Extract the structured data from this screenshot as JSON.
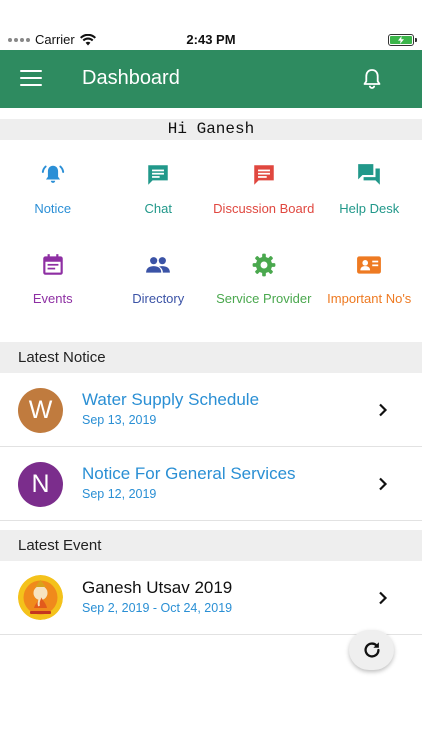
{
  "status_bar": {
    "carrier": "Carrier",
    "time": "2:43 PM",
    "battery_color": "#3bb54a"
  },
  "app_bar": {
    "title": "Dashboard",
    "menu_icon": "menu-icon",
    "notification_icon": "bell-icon",
    "background_color": "#2e8b60"
  },
  "greeting": "Hi Ganesh",
  "grid": {
    "items": [
      {
        "label": "Notice",
        "icon": "bell-ring-icon",
        "color": "#2b8fd6"
      },
      {
        "label": "Chat",
        "icon": "chat-icon",
        "color": "#21988a"
      },
      {
        "label": "Discussion Board",
        "icon": "message-icon",
        "color": "#e0473f"
      },
      {
        "label": "Help Desk",
        "icon": "forum-icon",
        "color": "#21988a"
      },
      {
        "label": "Events",
        "icon": "calendar-icon",
        "color": "#8e2fa3"
      },
      {
        "label": "Directory",
        "icon": "people-icon",
        "color": "#3b53a6"
      },
      {
        "label": "Service Provider",
        "icon": "gear-icon",
        "color": "#4aa84e"
      },
      {
        "label": "Important No's",
        "icon": "contact-card-icon",
        "color": "#ee7a22"
      }
    ]
  },
  "latest_notice": {
    "heading": "Latest Notice",
    "items": [
      {
        "initial": "W",
        "title": "Water Supply Schedule",
        "date": "Sep 13, 2019",
        "avatar_color": "#c07b3e"
      },
      {
        "initial": "N",
        "title": "Notice For General Services",
        "date": "Sep 12, 2019",
        "avatar_color": "#7b2d8c"
      }
    ]
  },
  "latest_event": {
    "heading": "Latest Event",
    "items": [
      {
        "title": "Ganesh Utsav 2019",
        "date": "Sep 2, 2019 - Oct 24, 2019",
        "avatar_icon": "ganesh-image"
      }
    ]
  },
  "fab": {
    "icon": "refresh-icon"
  }
}
